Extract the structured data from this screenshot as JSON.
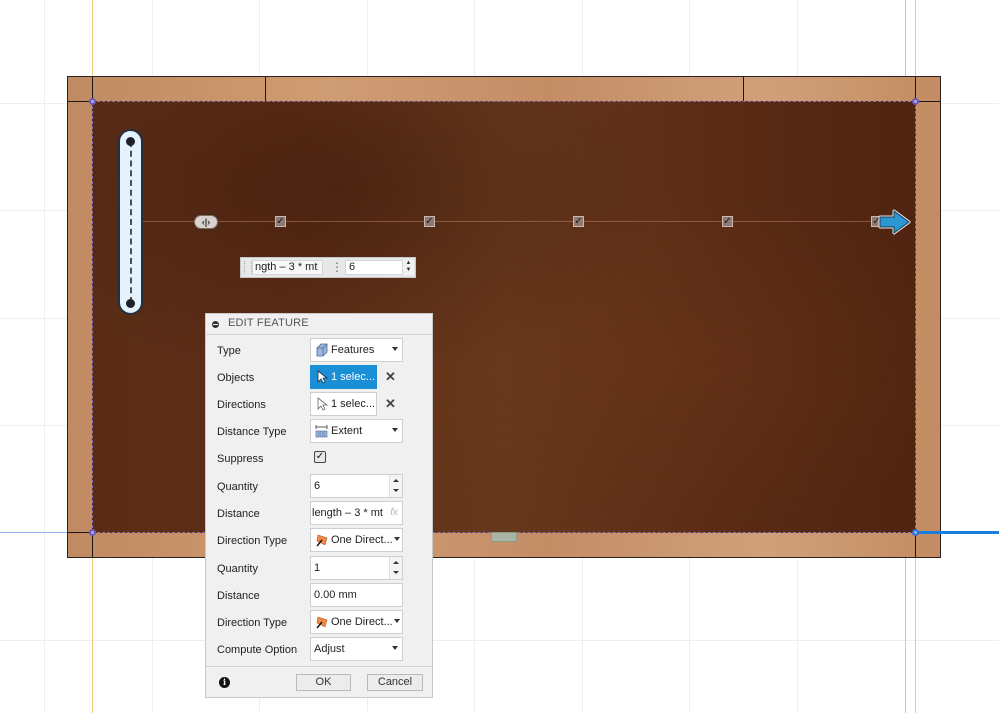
{
  "canvas": {
    "colors": {
      "grid": "#eeeeee",
      "axis_x_blue": "#1a7de0",
      "axis_green": "#9be89b",
      "axis_orange": "#f5c97a",
      "panel_wood": "#5e2e17",
      "frame_wood": "#c8956c",
      "selection_blue": "#1a8fd6"
    },
    "pattern_markers": {
      "quantity_checks": 6,
      "start_handle_icon": "bidirectional-handle-icon",
      "direction_arrow_icon": "arrow-right-icon"
    },
    "inline_editor": {
      "distance_expression": "ngth – 3 * mt",
      "quantity_value": "6"
    }
  },
  "dialog": {
    "title": "EDIT FEATURE",
    "rows": {
      "type": {
        "label": "Type",
        "value": "Features",
        "icon": "feature-cube-icon"
      },
      "objects": {
        "label": "Objects",
        "value": "1 selec...",
        "icon": "cursor-arrow-icon"
      },
      "directions": {
        "label": "Directions",
        "value": "1 selec...",
        "icon": "cursor-arrow-icon"
      },
      "distance_type": {
        "label": "Distance Type",
        "value": "Extent",
        "icon": "extent-icon"
      },
      "suppress": {
        "label": "Suppress",
        "checked": true,
        "check_glyph": "✓"
      },
      "quantity1": {
        "label": "Quantity",
        "value": "6"
      },
      "distance1": {
        "label": "Distance",
        "value": "length – 3 * mt",
        "fx": "fx"
      },
      "direction_type1": {
        "label": "Direction Type",
        "value": "One Direct...",
        "icon": "one-direction-flag-icon"
      },
      "quantity2": {
        "label": "Quantity",
        "value": "1"
      },
      "distance2": {
        "label": "Distance",
        "value": "0.00 mm"
      },
      "direction_type2": {
        "label": "Direction Type",
        "value": "One Direct...",
        "icon": "one-direction-flag-icon"
      },
      "compute_option": {
        "label": "Compute Option",
        "value": "Adjust"
      }
    },
    "footer": {
      "info_glyph": "i",
      "ok_label": "OK",
      "cancel_label": "Cancel"
    }
  }
}
